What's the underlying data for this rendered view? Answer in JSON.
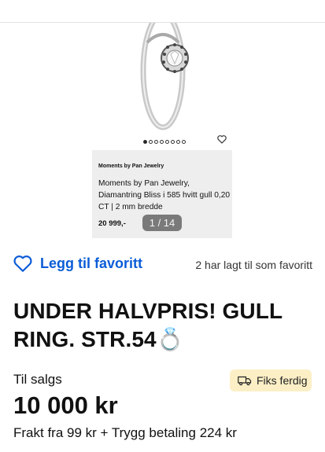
{
  "gallery": {
    "counter": "1 / 14",
    "image_count": 8,
    "active_index": 0,
    "card": {
      "brand": "Moments by Pan Jewelry",
      "title": "Moments by Pan Jewelry, Diamantring Bliss i 585 hvitt gull 0,20 CT | 2 mm bredde",
      "price": "20 999,-"
    }
  },
  "favorite": {
    "label": "Legg til favoritt",
    "count_text": "2 har lagt til som favoritt",
    "color": "#0b5cd7"
  },
  "listing": {
    "title": "UNDER HALVPRIS! GULL RING. STR.54💍",
    "status": "Til salgs",
    "badge": "Fiks ferdig",
    "badge_color": "#fcefc6",
    "price": "10 000 kr",
    "shipping": "Frakt fra 99 kr + Trygg betaling 224 kr"
  },
  "icons": {
    "favorite": "heart-outline-icon",
    "badge": "delivery-truck-icon",
    "photo_favorite": "heart-small-icon"
  }
}
